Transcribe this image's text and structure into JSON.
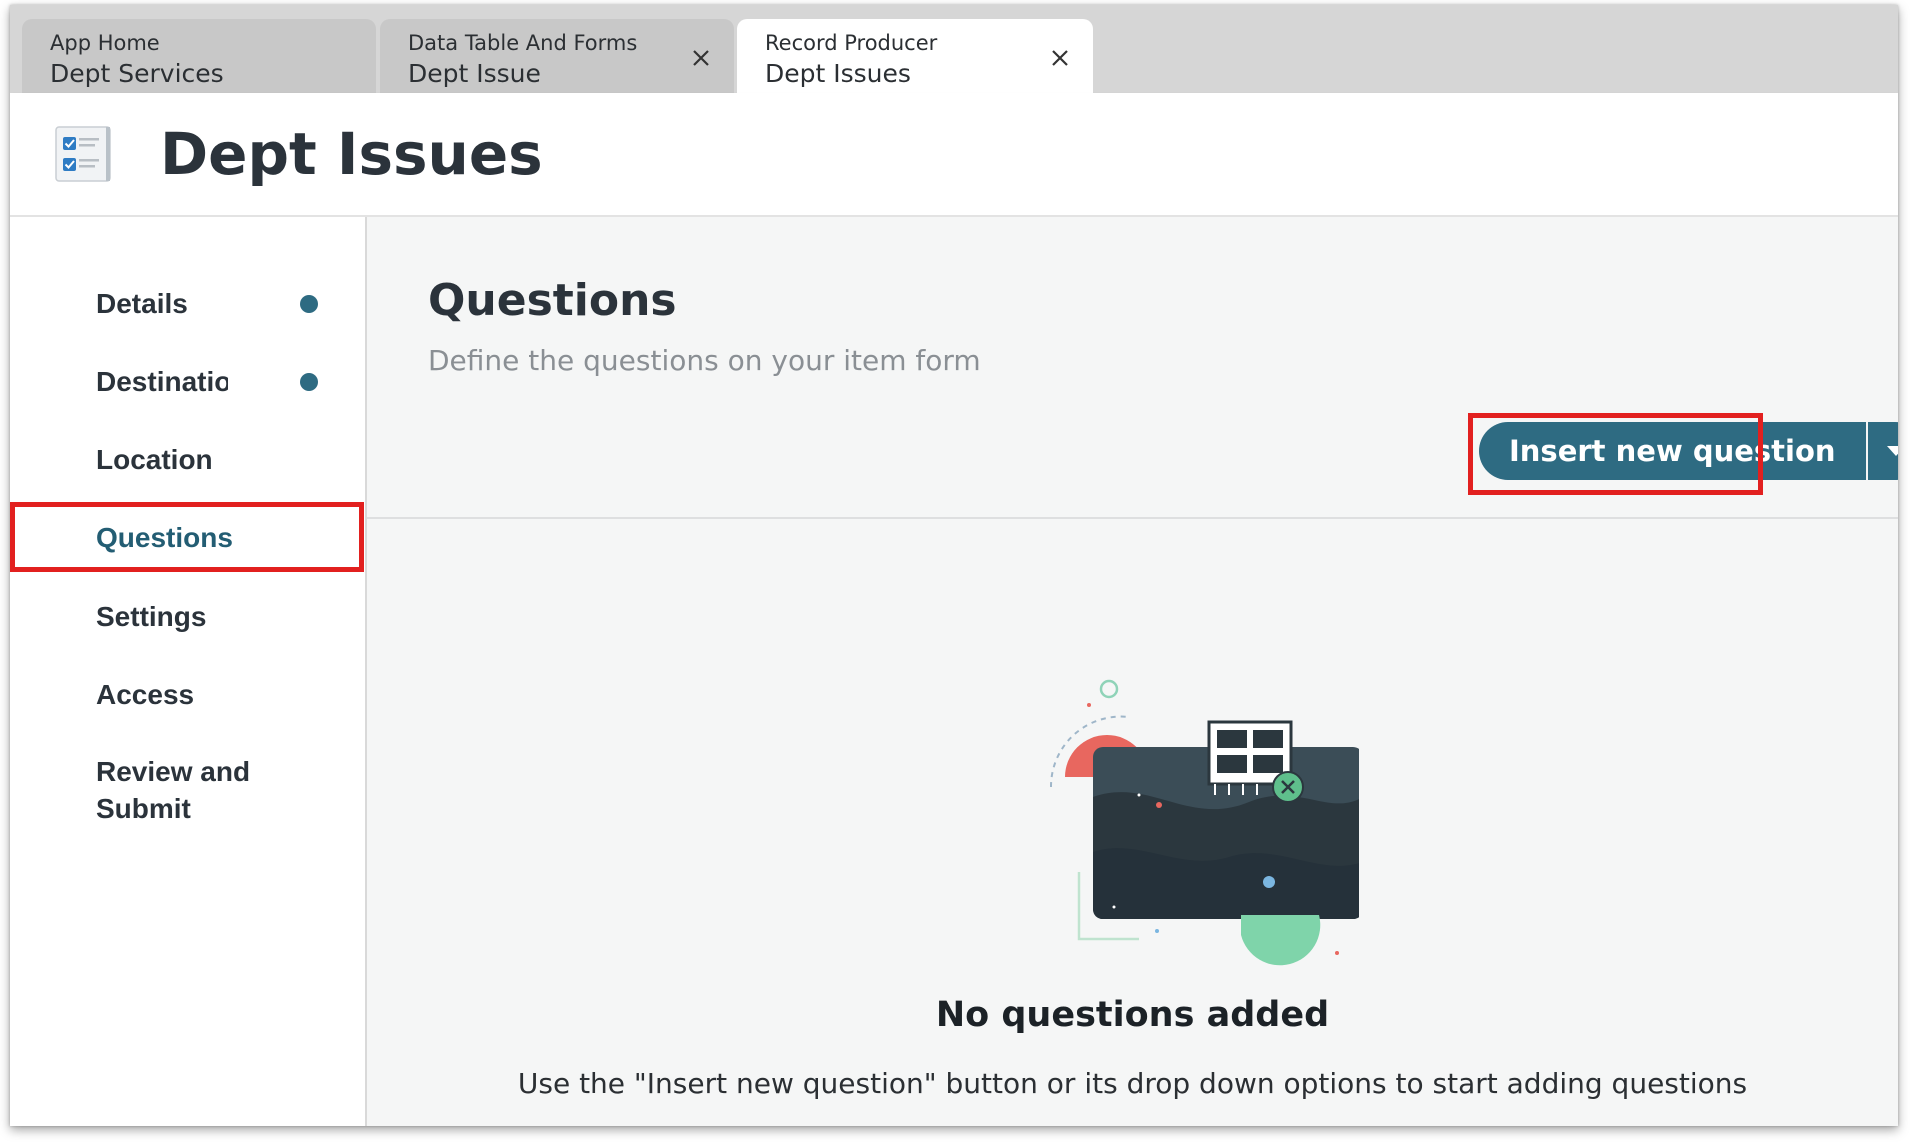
{
  "tabs": [
    {
      "line1": "App Home",
      "line2": "Dept Services",
      "active": false,
      "closable": false
    },
    {
      "line1": "Data Table And Forms",
      "line2": "Dept Issue",
      "active": false,
      "closable": true
    },
    {
      "line1": "Record Producer",
      "line2": "Dept Issues",
      "active": true,
      "closable": true
    }
  ],
  "header": {
    "title": "Dept Issues",
    "icon": "form-checklist-icon"
  },
  "sidebar": {
    "items": [
      {
        "label": "Details",
        "status_dot": true
      },
      {
        "label": "Destination",
        "status_dot": true
      },
      {
        "label": "Location",
        "status_dot": false
      },
      {
        "label": "Questions",
        "status_dot": false,
        "active": true
      },
      {
        "label": "Settings",
        "status_dot": false
      },
      {
        "label": "Access",
        "status_dot": false
      },
      {
        "label": "Review and Submit",
        "status_dot": false
      }
    ]
  },
  "main": {
    "title": "Questions",
    "subtitle": "Define the questions on your item form",
    "insert_button_label": "Insert new question",
    "dropdown_icon": "caret-down-icon",
    "empty_state": {
      "illustration": "empty-board-illustration",
      "title": "No questions added",
      "description": "Use the \"Insert new question\" button or its drop down options to start adding questions"
    }
  },
  "colors": {
    "accent": "#2e6b82",
    "highlight": "#e2201f",
    "tab_inactive": "#c8c8c8",
    "tabbar_bg": "#d6d6d6",
    "main_bg": "#f5f6f6"
  }
}
